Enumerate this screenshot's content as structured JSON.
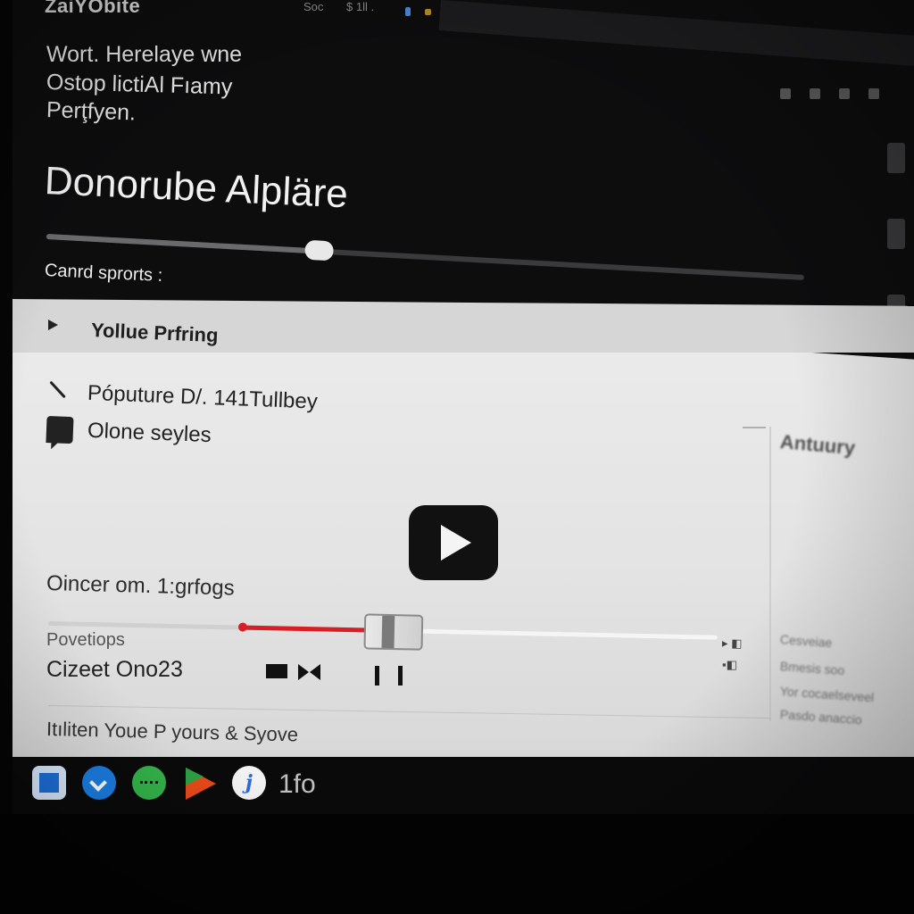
{
  "window": {
    "brand": "ZaiYObite",
    "tab_meta": [
      "Soc",
      "$ 1ll ."
    ]
  },
  "intro": {
    "line1": "Wort. Herelaye wne",
    "line2": "Ostop lictiAl Fıamy",
    "line3": "Perţfyen."
  },
  "hero": {
    "title": "Donorube Alpläre",
    "slider_value": 0.36,
    "caption": "Canrd sprorts :"
  },
  "panel": {
    "header": "Yollue Prfring",
    "items": [
      {
        "icon": "phone-icon",
        "label": "Póputure D/. 141Tullbey"
      },
      {
        "icon": "message-icon",
        "label": "Olone seyles"
      }
    ],
    "status": "Oincer om. 1:grfogs",
    "label": "Povetiops",
    "counter": "Cizeet Ono23",
    "footer": "Itıliten Youe P yours & Syove"
  },
  "player": {
    "progress": 0.48,
    "buffered_start": 0.29,
    "play_icon": "play-icon",
    "controls": [
      "stop-icon",
      "skip-icon",
      "pause-icon"
    ]
  },
  "right_column": {
    "heading": "Antuury",
    "lines": [
      "Cesveiae",
      "Bmesis soo",
      "Yor cocaelseveel",
      "Pasdo anaccio"
    ]
  },
  "dock": {
    "apps": [
      "finder-icon",
      "messenger-icon",
      "messages-icon",
      "play-store-icon",
      "jira-icon"
    ],
    "label": "1fo"
  },
  "colors": {
    "accent_red": "#d81f26",
    "background_dark": "#0d0d0e",
    "panel_light": "#e6e6e6"
  }
}
